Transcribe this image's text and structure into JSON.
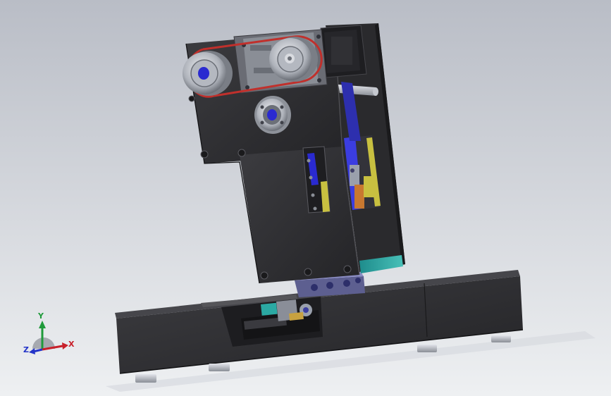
{
  "triad": {
    "y_label": "Y",
    "x_label": "X",
    "z_label": "Z",
    "colors": {
      "x": "#c8202a",
      "y": "#1f9a3a",
      "z": "#2434c8"
    }
  },
  "palette": {
    "body_dark": "#2b2b2e",
    "body_mid": "#3a3a3e",
    "accent_red": "#c0302c",
    "accent_blue": "#2a2ad0",
    "accent_yellow": "#c8c040",
    "accent_teal": "#2aa0a0",
    "accent_orange": "#c87830",
    "silver": "#b8bcc4"
  }
}
